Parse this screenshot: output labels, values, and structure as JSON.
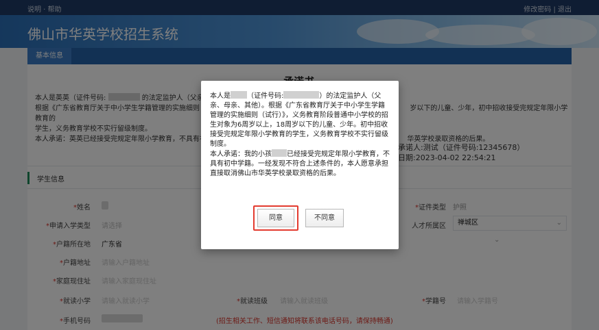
{
  "topbar": {
    "left_text": "说明 · 帮助",
    "right_text": "修改密码 | 退出"
  },
  "app": {
    "title": "佛山市华英学校招生系统"
  },
  "nav": {
    "tab": "基本信息"
  },
  "letter": {
    "title": "承诺书",
    "line1_a": "本人是英英（证件号码:",
    "line1_b": "的法定监护人（父亲、",
    "line2_a": "根据《广东省教育厅关于中小学生学籍管理的实施细则（试",
    "line2_b": "岁以下的儿童、少年，初中招收接受完规定年限小学教育的",
    "line3": "学生，义务教育学校不实行留级制度。",
    "line4_a": "本人承诺：英英已经接受完规定年限小学教育，不具有初",
    "line4_b": "华英学校录取资格的后果。",
    "pledger": "承诺人:测试（证件号码:12345678）",
    "date": "日期:2023-04-02 22:54:21"
  },
  "section": {
    "title": "学生信息"
  },
  "form": {
    "name_label": "姓名",
    "id_type_label": "证件类型",
    "id_type_value": "护照",
    "grade_label": "申请入学类型",
    "grade_placeholder": "请选择",
    "talent_label": "人才所属区",
    "talent_value": "禅城区",
    "huji_label": "户籍所在地",
    "huji_value": "广东省",
    "huji_addr_label": "户籍地址",
    "huji_addr_placeholder": "请输入户籍地址",
    "home_label": "家庭现住址",
    "home_placeholder": "请输入家庭现住址",
    "school_label": "就读小学",
    "school_placeholder": "请输入就读小学",
    "class_label": "就读班级",
    "class_placeholder": "请输入就读班级",
    "xuejihao_label": "学籍号",
    "xuejihao_placeholder": "请输入学籍号",
    "phone_label": "手机号码",
    "phone_note": "(招生相关工作、短信通知将联系该电话号码，请保持畅通)"
  },
  "modal": {
    "p1_a": "本人是",
    "p1_b": "（证件号码:",
    "p1_c": "）的法定监护人（父亲、母亲、其他）。根据《广东省教育厅关于中小学生学籍管理的实施细则（试行）》，义务教育阶段普通中小学校的招生对象为6周岁以上，18周岁以下的儿童、少年。初中招收接受完规定年限小学教育的学生，义务教育学校不实行留级制度。",
    "p2_a": "本人承诺：我的小孩",
    "p2_b": "已经接受完规定年限小学教育，不具有初中学籍。一经发现不符合上述条件的，本人愿意承担直接取消佛山市华英学校录取资格的后果。",
    "agree": "同意",
    "disagree": "不同意"
  },
  "colors": {
    "accent": "#2563a8",
    "highlight": "#e33a2e",
    "required": "#d9342b"
  }
}
